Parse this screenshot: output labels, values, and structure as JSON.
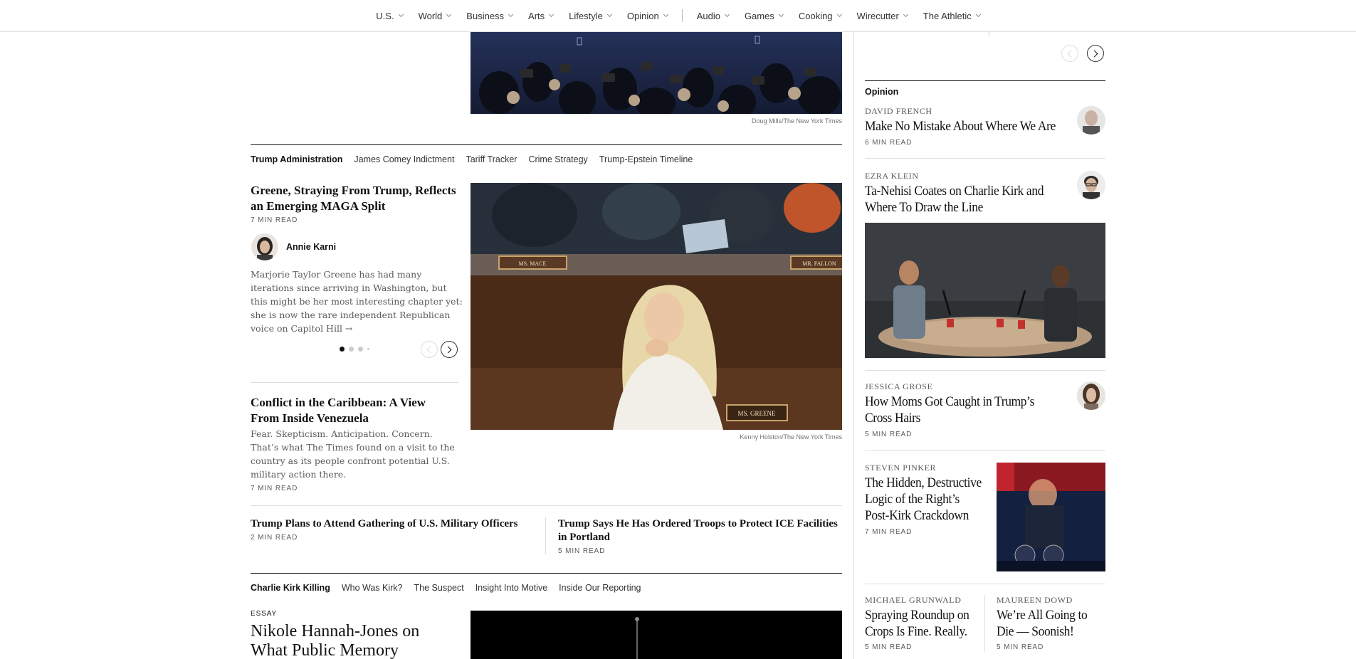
{
  "nav": {
    "items": [
      {
        "label": "U.S."
      },
      {
        "label": "World"
      },
      {
        "label": "Business"
      },
      {
        "label": "Arts"
      },
      {
        "label": "Lifestyle"
      },
      {
        "label": "Opinion"
      }
    ],
    "items2": [
      {
        "label": "Audio"
      },
      {
        "label": "Games"
      },
      {
        "label": "Cooking"
      },
      {
        "label": "Wirecutter"
      },
      {
        "label": "The Athletic"
      }
    ]
  },
  "top_photo": {
    "credit": "Doug Mills/The New York Times"
  },
  "trump_section": {
    "label": "Trump Administration",
    "links": [
      "James Comey Indictment",
      "Tariff Tracker",
      "Crime Strategy",
      "Trump-Epstein Timeline"
    ],
    "lead": {
      "headline": "Greene, Straying From Trump, Reflects an Emerging MAGA Split",
      "read_time": "7 MIN READ",
      "author": "Annie Karni",
      "summary": "Marjorie Taylor Greene has had many iterations since arriving in Washington, but this might be her most interesting chapter yet: she is now the rare independent Republican voice on Capitol Hill",
      "arrow": "→",
      "photo_credit": "Kenny Holston/The New York Times",
      "nameplates": [
        "MS. MACE",
        "MR. FALLON",
        "MS. GREENE"
      ]
    },
    "second": {
      "headline": "Conflict in the Caribbean: A View From Inside Venezuela",
      "summary": "Fear. Skepticism. Anticipation. Concern. That’s what The Times found on a visit to the country as its people confront potential U.S. military action there.",
      "read_time": "7 MIN READ"
    },
    "bottom": [
      {
        "headline": "Trump Plans to Attend Gathering of U.S. Military Officers",
        "read_time": "2 MIN READ"
      },
      {
        "headline": "Trump Says He Has Ordered Troops to Protect ICE Facilities in Portland",
        "read_time": "5 MIN READ"
      }
    ]
  },
  "kirk_section": {
    "label": "Charlie Kirk Killing",
    "links": [
      "Who Was Kirk?",
      "The Suspect",
      "Insight Into Motive",
      "Inside Our Reporting"
    ],
    "kicker": "ESSAY",
    "headline": "Nikole Hannah-Jones on What Public Memory"
  },
  "opinion": {
    "label": "Opinion",
    "items": [
      {
        "author": "DAVID FRENCH",
        "headline": "Make No Mistake About Where We Are",
        "read_time": "6 MIN READ"
      },
      {
        "author": "EZRA KLEIN",
        "headline": "Ta-Nehisi Coates on Charlie Kirk and Where To Draw the Line"
      },
      {
        "author": "JESSICA GROSE",
        "headline": "How Moms Got Caught in Trump’s Cross Hairs",
        "read_time": "5 MIN READ"
      },
      {
        "author": "STEVEN PINKER",
        "headline": "The Hidden, Destructive Logic of the Right’s Post-Kirk Crackdown",
        "read_time": "7 MIN READ"
      },
      {
        "author": "MICHAEL GRUNWALD",
        "headline": "Spraying Roundup on Crops Is Fine. Really.",
        "read_time": "5 MIN READ"
      },
      {
        "author": "MAUREEN DOWD",
        "headline": "We’re All Going to Die — Soonish!",
        "read_time": "5 MIN READ"
      }
    ]
  },
  "carousel": {
    "total_dots": 4,
    "active_dot": 1
  },
  "colors": {
    "text": "#121212",
    "meta": "#5a5a5a",
    "rule": "#dfdfdf",
    "podcast_bg": "#2b2d30",
    "photo_navy": "#1b2442"
  }
}
